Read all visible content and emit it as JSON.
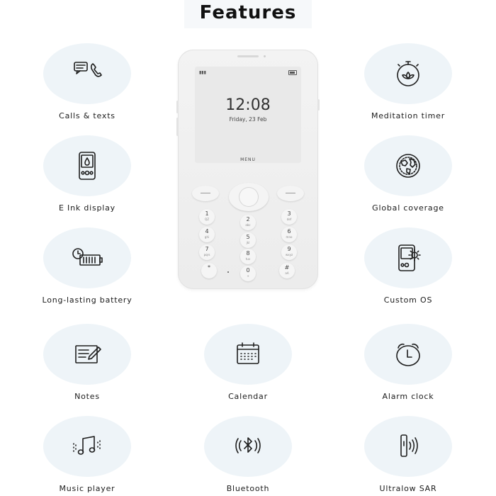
{
  "header": {
    "title": "Features"
  },
  "phone": {
    "time": "12:08",
    "date": "Friday, 23 Feb",
    "menu_label": "MENU",
    "keys": [
      {
        "digit": "1",
        "sub": "QZ"
      },
      {
        "digit": "2",
        "sub": "abc"
      },
      {
        "digit": "3",
        "sub": "def"
      },
      {
        "digit": "4",
        "sub": "ghi"
      },
      {
        "digit": "5",
        "sub": "jkl"
      },
      {
        "digit": "6",
        "sub": "mno"
      },
      {
        "digit": "7",
        "sub": "pqrs"
      },
      {
        "digit": "8",
        "sub": "tuv"
      },
      {
        "digit": "9",
        "sub": "wxyz"
      },
      {
        "digit": "*",
        "sub": ""
      },
      {
        "digit": "0",
        "sub": "+"
      },
      {
        "digit": "#",
        "sub": "aA"
      }
    ]
  },
  "features": [
    {
      "label": "Calls & texts",
      "icon": "chat-phone-icon"
    },
    {
      "label": "Meditation timer",
      "icon": "lotus-timer-icon"
    },
    {
      "label": "E Ink display",
      "icon": "phone-screen-icon"
    },
    {
      "label": "Global coverage",
      "icon": "globe-icon"
    },
    {
      "label": "Long-lasting battery",
      "icon": "battery-clock-icon"
    },
    {
      "label": "Custom OS",
      "icon": "phone-gear-icon"
    },
    {
      "label": "Notes",
      "icon": "notepad-pencil-icon"
    },
    {
      "label": "Calendar",
      "icon": "calendar-icon"
    },
    {
      "label": "Alarm clock",
      "icon": "alarm-clock-icon"
    },
    {
      "label": "Music player",
      "icon": "music-note-icon"
    },
    {
      "label": "Bluetooth",
      "icon": "bluetooth-icon"
    },
    {
      "label": "Ultralow SAR",
      "icon": "radiation-phone-icon"
    }
  ],
  "colors": {
    "circle_bg": "#eef4f8",
    "phone_body": "#ececec",
    "title_bg": "#f6f8fa"
  }
}
